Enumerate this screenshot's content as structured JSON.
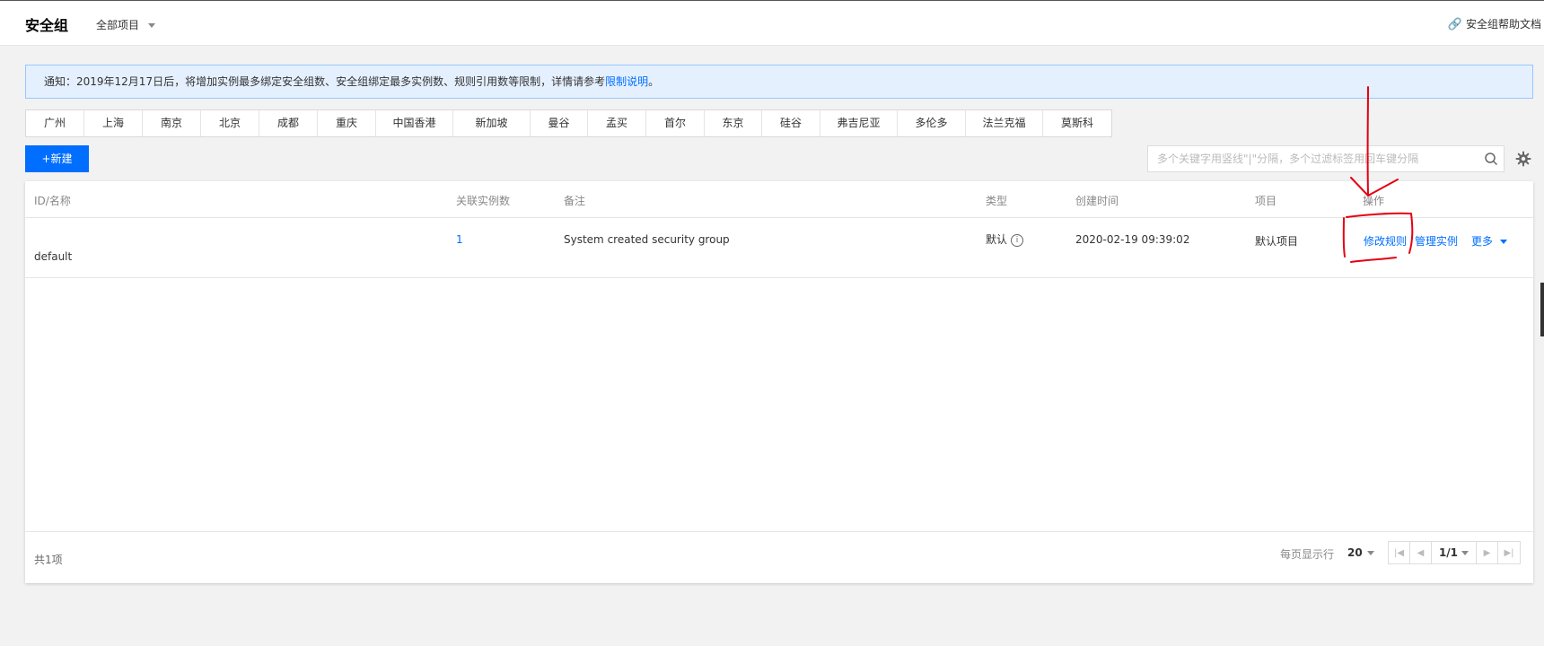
{
  "header": {
    "title": "安全组",
    "project_selector": "全部项目",
    "help_link": "安全组帮助文档"
  },
  "notice": {
    "text": "通知：2019年12月17日后，将增加实例最多绑定安全组数、安全组绑定最多实例数、规则引用数等限制，详情请参考",
    "link": "限制说明",
    "suffix": "。"
  },
  "regions": [
    "广州",
    "上海",
    "南京",
    "北京",
    "成都",
    "重庆",
    "中国香港",
    "新加坡",
    "曼谷",
    "孟买",
    "首尔",
    "东京",
    "硅谷",
    "弗吉尼亚",
    "多伦多",
    "法兰克福",
    "莫斯科"
  ],
  "toolbar": {
    "new_button": "+新建",
    "search_placeholder": "多个关键字用竖线\"|\"分隔，多个过滤标签用回车键分隔"
  },
  "table": {
    "columns": {
      "id_name": "ID/名称",
      "instances": "关联实例数",
      "remark": "备注",
      "type": "类型",
      "created": "创建时间",
      "project": "项目",
      "actions": "操作"
    },
    "rows": [
      {
        "name": "default",
        "instances": "1",
        "remark": "System created security group",
        "type": "默认",
        "created": "2020-02-19 09:39:02",
        "project": "默认项目",
        "action_modify": "修改规则",
        "action_manage": "管理实例",
        "action_more": "更多"
      }
    ]
  },
  "pagination": {
    "total": "共1项",
    "per_page_label": "每页显示行",
    "per_page": "20",
    "current_page": "1/1"
  },
  "colors": {
    "accent": "#006eff",
    "notice_bg": "#e5f0ff",
    "annotation": "#e60012"
  },
  "icons": [
    "link-icon",
    "search-icon",
    "gear-icon",
    "info-icon",
    "first-page-icon",
    "prev-page-icon",
    "next-page-icon",
    "last-page-icon"
  ]
}
